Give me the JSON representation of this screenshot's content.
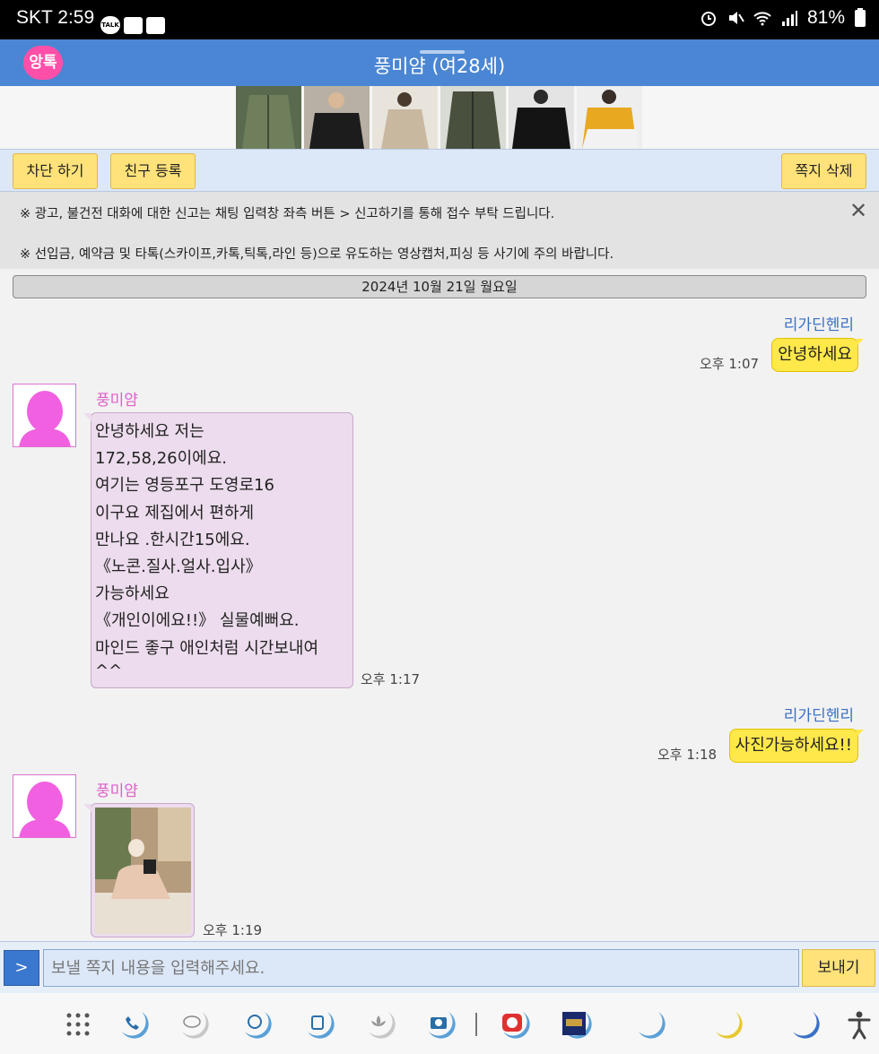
{
  "status_bar": {
    "time": "SKT 2:59",
    "talk_badge": "TALK",
    "battery": "81%"
  },
  "header": {
    "logo_text": "앙톡",
    "title": "풍미얌 (여28세)"
  },
  "toolbar": {
    "block_label": "차단 하기",
    "add_friend_label": "친구 등록",
    "delete_label": "쪽지 삭제"
  },
  "notice": {
    "line1": "※ 광고, 불건전 대화에 대한 신고는 채팅 입력창 좌측 버튼 > 신고하기를 통해 접수 부탁 드립니다.",
    "line2": "※ 선입금, 예약금 및 타톡(스카이프,카톡,틱톡,라인 등)으로 유도하는 영상캡처,피싱 등 사기에 주의 바랍니다."
  },
  "date_separator": "2024년 10월 21일 월요일",
  "messages": [
    {
      "sender": "리가딘헨리",
      "text": "안녕하세요",
      "time": "오후 1:07"
    },
    {
      "sender": "풍미얌",
      "lines": [
        "안녕하세요 저는",
        "172,58,26이에요.",
        "여기는 영등포구 도영로16",
        "이구요 제집에서 편하게",
        "만나요 .한시간15에요.",
        "《노콘.질사.얼사.입사》",
        "가능하세요",
        "《개인이에요!!》 실물예뻐요.",
        "마인드 좋구 애인처럼 시간보내여",
        "^^"
      ],
      "time": "오후 1:17"
    },
    {
      "sender": "리가딘헨리",
      "text": "사진가능하세요!!",
      "time": "오후 1:18"
    },
    {
      "sender": "풍미얌",
      "image": "photo-attachment",
      "time": "오후 1:19"
    }
  ],
  "input": {
    "toggle_label": ">",
    "placeholder": "보낼 쪽지 내용을 입력해주세요.",
    "send_label": "보내기"
  },
  "colors": {
    "header": "#4a86d4",
    "my_bubble": "#ffe84a",
    "their_bubble": "#ecdced",
    "their_name": "#e060c8",
    "my_name": "#3a6fc4",
    "button": "#ffe27a"
  },
  "nav_icons": [
    "app-drawer-icon",
    "phone-icon",
    "chat-icon",
    "browser-icon",
    "wallet-icon",
    "flower-icon",
    "camera-icon",
    "app-icon-red",
    "game-icon",
    "moon-icon",
    "moon-icon-yellow",
    "moon-icon-blue",
    "accessibility-icon"
  ]
}
